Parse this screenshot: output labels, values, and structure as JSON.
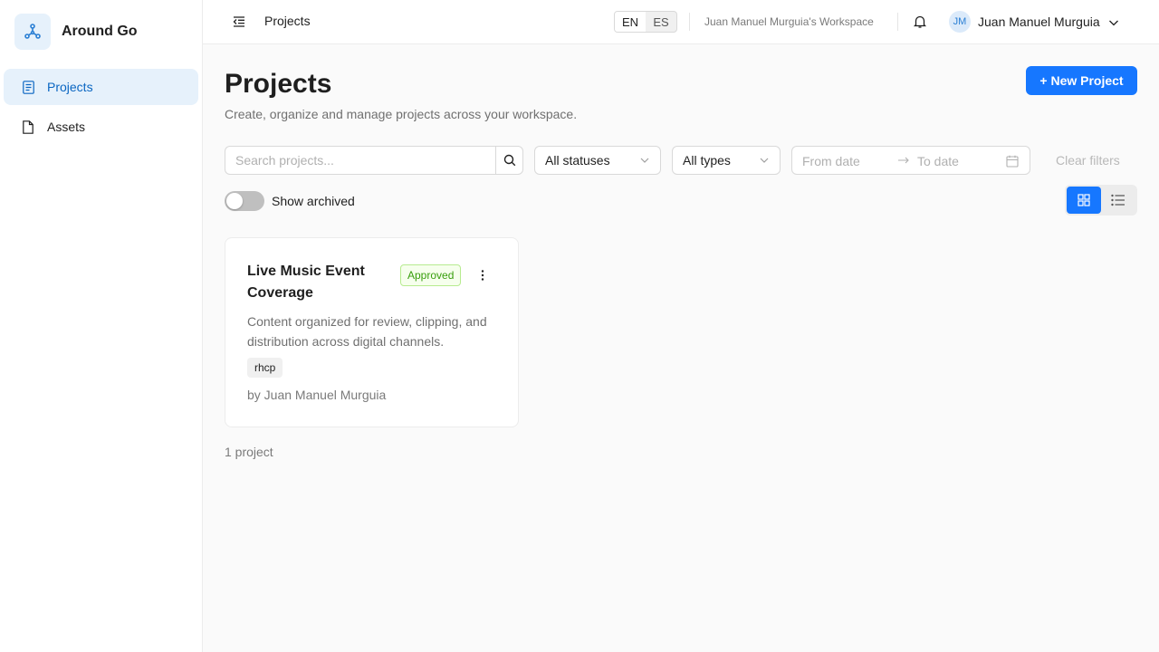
{
  "brand": {
    "name": "Around Go",
    "logo_icon": "network-nodes-icon",
    "logo_bg": "#e6f1fb"
  },
  "sidebar": {
    "items": [
      {
        "label": "Projects",
        "icon": "project-document-icon",
        "active": true
      },
      {
        "label": "Assets",
        "icon": "file-icon",
        "active": false
      }
    ]
  },
  "header": {
    "title": "Projects",
    "languages": [
      {
        "code": "EN",
        "selected": true
      },
      {
        "code": "ES",
        "selected": false
      }
    ],
    "workspace": "Juan Manuel Murguia's Workspace",
    "user": {
      "initials": "JM",
      "name": "Juan Manuel Murguia"
    }
  },
  "page": {
    "title": "Projects",
    "subtitle": "Create, organize and manage projects across your workspace.",
    "new_project_label": "+ New Project"
  },
  "filters": {
    "search_placeholder": "Search projects...",
    "status_value": "All statuses",
    "type_value": "All types",
    "from_placeholder": "From date",
    "to_placeholder": "To date",
    "clear_label": "Clear filters"
  },
  "archived_toggle": {
    "label": "Show archived",
    "on": false
  },
  "view_mode": {
    "selected": "grid",
    "options": [
      "grid",
      "list"
    ]
  },
  "projects": [
    {
      "title": "Live Music Event Coverage",
      "status": "Approved",
      "description": "Content organized for review, clipping, and distribution across digital channels.",
      "tags": [
        "rhcp"
      ],
      "author": "by Juan Manuel Murguia"
    }
  ],
  "project_count": "1 project",
  "colors": {
    "accent": "#1677ff",
    "sidebar_active_bg": "#e6f1fb",
    "sidebar_active_text": "#0a66c2",
    "status_approved_text": "#389e0d",
    "status_approved_bg": "#f6ffed",
    "status_approved_border": "#b7eb8f"
  }
}
